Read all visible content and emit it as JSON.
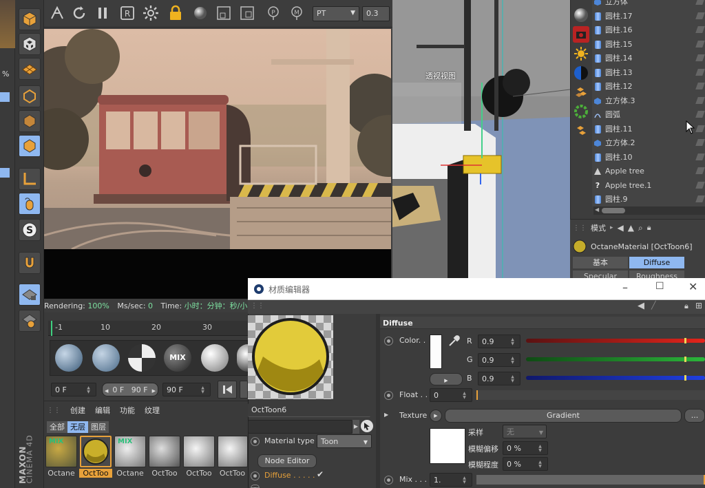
{
  "render_toolbar": {
    "mode_select": "PT",
    "value_field": "0.3"
  },
  "viewport_label": "透视视图",
  "render_status": {
    "rendering_label": "Rendering:",
    "rendering_value": "100%",
    "ms_label": "Ms/sec:",
    "ms_value": "0",
    "time_label": "Time:",
    "time_value": "小时：分钟：秒/小时：分"
  },
  "timeline": {
    "ticks": [
      "-1",
      "10",
      "20",
      "30"
    ],
    "start_field": "0 F",
    "range_field": "0 F   90 F",
    "end_field": "90 F"
  },
  "preview_balls": {
    "mix_label": "MIX"
  },
  "material_manager": {
    "menu": [
      "创建",
      "编辑",
      "功能",
      "纹理"
    ],
    "filter_tabs": [
      "全部",
      "无层",
      "图层"
    ],
    "materials": [
      "Octane",
      "OctToo",
      "Octane",
      "OctToo",
      "OctToo",
      "OctToo"
    ],
    "mix_tag": "MIX",
    "brand_top": "MAXON",
    "brand_bottom": "CINEMA 4D"
  },
  "objects": [
    {
      "label": "立方体",
      "icon": "cube-icon"
    },
    {
      "label": "圆柱.17",
      "icon": "cylinder-icon"
    },
    {
      "label": "圆柱.16",
      "icon": "cylinder-icon"
    },
    {
      "label": "圆柱.15",
      "icon": "cylinder-icon"
    },
    {
      "label": "圆柱.14",
      "icon": "cylinder-icon"
    },
    {
      "label": "圆柱.13",
      "icon": "cylinder-icon"
    },
    {
      "label": "圆柱.12",
      "icon": "cylinder-icon"
    },
    {
      "label": "立方体.3",
      "icon": "cube-icon"
    },
    {
      "label": "圆弧",
      "icon": "arc-icon"
    },
    {
      "label": "圆柱.11",
      "icon": "cylinder-icon"
    },
    {
      "label": "立方体.2",
      "icon": "cube-icon"
    },
    {
      "label": "圆柱.10",
      "icon": "cylinder-icon"
    },
    {
      "label": "Apple tree",
      "icon": "tree-icon"
    },
    {
      "label": "Apple tree.1",
      "icon": "question-icon"
    },
    {
      "label": "圆柱.9",
      "icon": "cylinder-icon"
    }
  ],
  "attributes": {
    "mode_label": "模式",
    "material_name": "OctaneMaterial [OctToon6]",
    "tabs": [
      "基本",
      "Diffuse",
      "Specular",
      "Roughness"
    ]
  },
  "material_editor": {
    "title": "材质编辑器",
    "material_name": "OctToon6",
    "material_type_label": "Material type",
    "material_type_value": "Toon",
    "node_editor_label": "Node Editor",
    "channel_diffuse": "Diffuse . . . . .",
    "section_title": "Diffuse",
    "color_label": "Color. .",
    "r_label": "R",
    "r_value": "0.9",
    "g_label": "G",
    "g_value": "0.9",
    "b_label": "B",
    "b_value": "0.9",
    "float_label": "Float . .",
    "float_value": "0",
    "texture_label": "Texture",
    "texture_button": "Gradient",
    "more_button": "...",
    "sample_label": "采样",
    "sample_value": "无",
    "blur_offset_label": "模糊偏移",
    "blur_offset_value": "0 %",
    "blur_level_label": "模糊程度",
    "blur_level_value": "0 %",
    "mix_label": "Mix . . .",
    "mix_value": "1."
  },
  "colors": {
    "accent_blue": "#8fb8f0",
    "highlight_yellow": "#e6c32a",
    "active_orange": "#e8a13a"
  }
}
